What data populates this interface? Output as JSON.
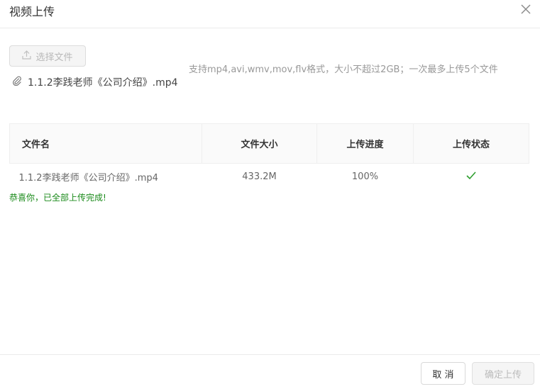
{
  "dialog": {
    "title": "视频上传",
    "close_icon": "close-icon"
  },
  "upload": {
    "select_button_label": "选择文件",
    "select_button_icon": "upload-icon",
    "hint": "支持mp4,avi,wmv,mov,flv格式，大小不超过2GB；一次最多上传5个文件",
    "selected_file_icon": "paperclip-icon",
    "selected_file_name": "1.1.2李践老师《公司介绍》.mp4"
  },
  "table": {
    "headers": {
      "filename": "文件名",
      "size": "文件大小",
      "progress": "上传进度",
      "status": "上传状态"
    },
    "rows": [
      {
        "filename": "1.1.2李践老师《公司介绍》.mp4",
        "size": "433.2M",
        "progress": "100%",
        "status_icon": "checkmark-icon"
      }
    ]
  },
  "message": {
    "success": "恭喜你，已全部上传完成!"
  },
  "footer": {
    "cancel_label": "取 消",
    "confirm_label": "确定上传"
  },
  "colors": {
    "success_green": "#1a8a1a",
    "disabled_text": "#b9b9b9",
    "border": "#ebebeb"
  }
}
